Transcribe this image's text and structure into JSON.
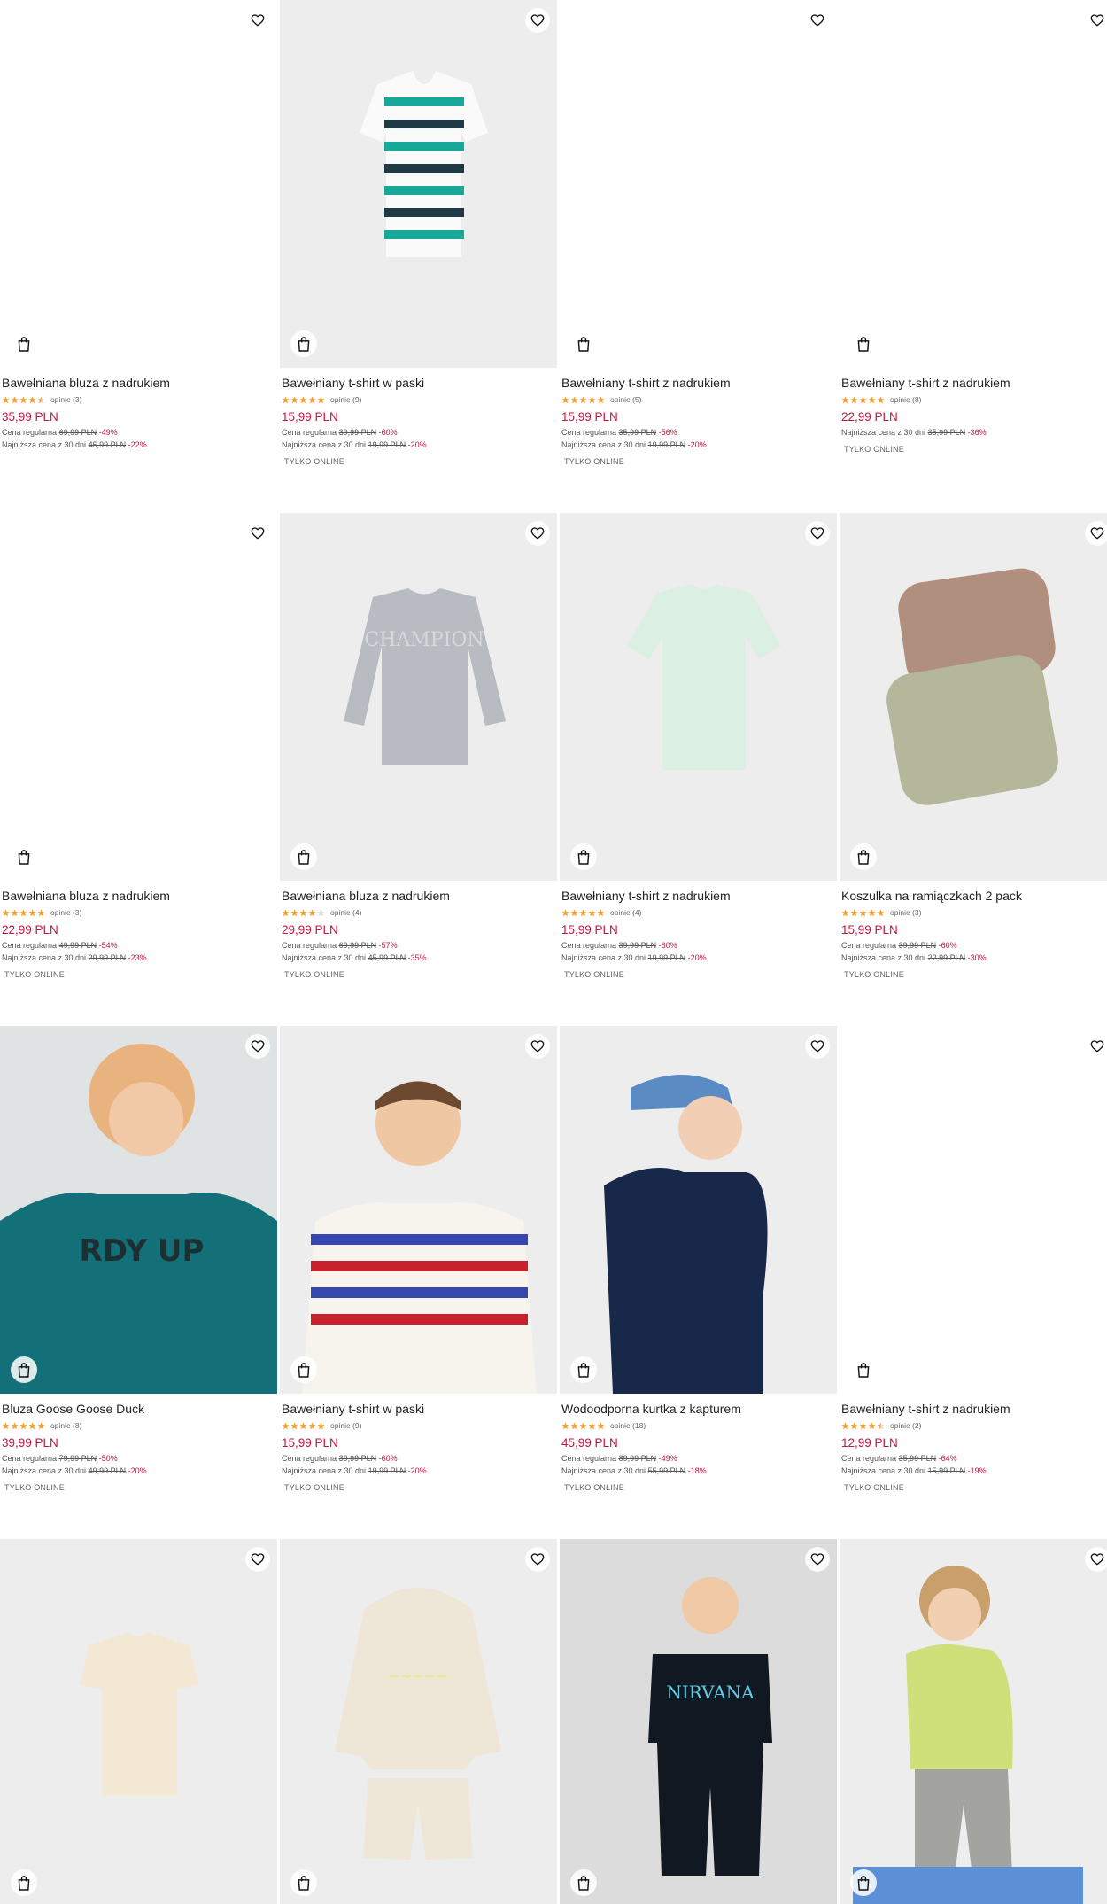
{
  "colors": {
    "sale": "#c4153b",
    "star": "#f0a23b",
    "star_empty": "#d9d9d9"
  },
  "icons": {
    "favorite": "heart-outline-icon",
    "cart": "shopping-bag-icon"
  },
  "products": [
    {
      "name": "Bawełniana bluza z nadrukiem",
      "rating": 4.5,
      "reviews": "opinie (3)",
      "price": "35,99 PLN",
      "regular_label": "Cena regularna",
      "regular_price": "69,99 PLN",
      "regular_discount": "-49%",
      "lowest_label": "Najniższa cena z 30 dni",
      "lowest_price": "45,99 PLN",
      "lowest_discount": "-22%",
      "online": ""
    },
    {
      "name": "Bawełniany t-shirt w paski",
      "rating": 5,
      "reviews": "opinie (9)",
      "price": "15,99 PLN",
      "regular_label": "Cena regularna",
      "regular_price": "39,99 PLN",
      "regular_discount": "-60%",
      "lowest_label": "Najniższa cena z 30 dni",
      "lowest_price": "19,99 PLN",
      "lowest_discount": "-20%",
      "online": "TYLKO ONLINE"
    },
    {
      "name": "Bawełniany t-shirt z nadrukiem",
      "rating": 5,
      "reviews": "opinie (5)",
      "price": "15,99 PLN",
      "regular_label": "Cena regularna",
      "regular_price": "35,99 PLN",
      "regular_discount": "-56%",
      "lowest_label": "Najniższa cena z 30 dni",
      "lowest_price": "19,99 PLN",
      "lowest_discount": "-20%",
      "online": "TYLKO ONLINE"
    },
    {
      "name": "Bawełniany t-shirt z nadrukiem",
      "rating": 5,
      "reviews": "opinie (8)",
      "price": "22,99 PLN",
      "regular_label": "",
      "regular_price": "",
      "regular_discount": "",
      "lowest_label": "Najniższa cena z 30 dni",
      "lowest_price": "35,99 PLN",
      "lowest_discount": "-36%",
      "online": "TYLKO ONLINE"
    },
    {
      "name": "Bawełniana bluza z nadrukiem",
      "rating": 5,
      "reviews": "opinie (3)",
      "price": "22,99 PLN",
      "regular_label": "Cena regularna",
      "regular_price": "49,99 PLN",
      "regular_discount": "-54%",
      "lowest_label": "Najniższa cena z 30 dni",
      "lowest_price": "29,99 PLN",
      "lowest_discount": "-23%",
      "online": "TYLKO ONLINE"
    },
    {
      "name": "Bawełniana bluza z nadrukiem",
      "rating": 4,
      "reviews": "opinie (4)",
      "price": "29,99 PLN",
      "regular_label": "Cena regularna",
      "regular_price": "69,99 PLN",
      "regular_discount": "-57%",
      "lowest_label": "Najniższa cena z 30 dni",
      "lowest_price": "45,99 PLN",
      "lowest_discount": "-35%",
      "online": "TYLKO ONLINE"
    },
    {
      "name": "Bawełniany t-shirt z nadrukiem",
      "rating": 5,
      "reviews": "opinie (4)",
      "price": "15,99 PLN",
      "regular_label": "Cena regularna",
      "regular_price": "39,99 PLN",
      "regular_discount": "-60%",
      "lowest_label": "Najniższa cena z 30 dni",
      "lowest_price": "19,99 PLN",
      "lowest_discount": "-20%",
      "online": "TYLKO ONLINE"
    },
    {
      "name": "Koszulka na ramiączkach 2 pack",
      "rating": 5,
      "reviews": "opinie (3)",
      "price": "15,99 PLN",
      "regular_label": "Cena regularna",
      "regular_price": "39,99 PLN",
      "regular_discount": "-60%",
      "lowest_label": "Najniższa cena z 30 dni",
      "lowest_price": "22,99 PLN",
      "lowest_discount": "-30%",
      "online": "TYLKO ONLINE"
    },
    {
      "name": "Bluza Goose Goose Duck",
      "rating": 5,
      "reviews": "opinie (8)",
      "price": "39,99 PLN",
      "regular_label": "Cena regularna",
      "regular_price": "79,99 PLN",
      "regular_discount": "-50%",
      "lowest_label": "Najniższa cena z 30 dni",
      "lowest_price": "49,99 PLN",
      "lowest_discount": "-20%",
      "online": "TYLKO ONLINE"
    },
    {
      "name": "Bawełniany t-shirt w paski",
      "rating": 5,
      "reviews": "opinie (9)",
      "price": "15,99 PLN",
      "regular_label": "Cena regularna",
      "regular_price": "39,99 PLN",
      "regular_discount": "-60%",
      "lowest_label": "Najniższa cena z 30 dni",
      "lowest_price": "19,99 PLN",
      "lowest_discount": "-20%",
      "online": "TYLKO ONLINE"
    },
    {
      "name": "Wodoodporna kurtka z kapturem",
      "rating": 5,
      "reviews": "opinie (18)",
      "price": "45,99 PLN",
      "regular_label": "Cena regularna",
      "regular_price": "89,99 PLN",
      "regular_discount": "-49%",
      "lowest_label": "Najniższa cena z 30 dni",
      "lowest_price": "55,99 PLN",
      "lowest_discount": "-18%",
      "online": "TYLKO ONLINE"
    },
    {
      "name": "Bawełniany t-shirt z nadrukiem",
      "rating": 4.5,
      "reviews": "opinie (2)",
      "price": "12,99 PLN",
      "regular_label": "Cena regularna",
      "regular_price": "35,99 PLN",
      "regular_discount": "-64%",
      "lowest_label": "Najniższa cena z 30 dni",
      "lowest_price": "15,99 PLN",
      "lowest_discount": "-19%",
      "online": "TYLKO ONLINE"
    },
    {
      "name": "",
      "rating": 0,
      "reviews": "",
      "price": "",
      "regular_label": "",
      "regular_price": "",
      "regular_discount": "",
      "lowest_label": "",
      "lowest_price": "",
      "lowest_discount": "",
      "online": ""
    },
    {
      "name": "",
      "rating": 0,
      "reviews": "",
      "price": "",
      "regular_label": "",
      "regular_price": "",
      "regular_discount": "",
      "lowest_label": "",
      "lowest_price": "",
      "lowest_discount": "",
      "online": ""
    },
    {
      "name": "",
      "rating": 0,
      "reviews": "",
      "price": "",
      "regular_label": "",
      "regular_price": "",
      "regular_discount": "",
      "lowest_label": "",
      "lowest_price": "",
      "lowest_discount": "",
      "online": ""
    },
    {
      "name": "",
      "rating": 0,
      "reviews": "",
      "price": "",
      "regular_label": "",
      "regular_price": "",
      "regular_discount": "",
      "lowest_label": "",
      "lowest_price": "",
      "lowest_discount": "",
      "online": ""
    }
  ]
}
